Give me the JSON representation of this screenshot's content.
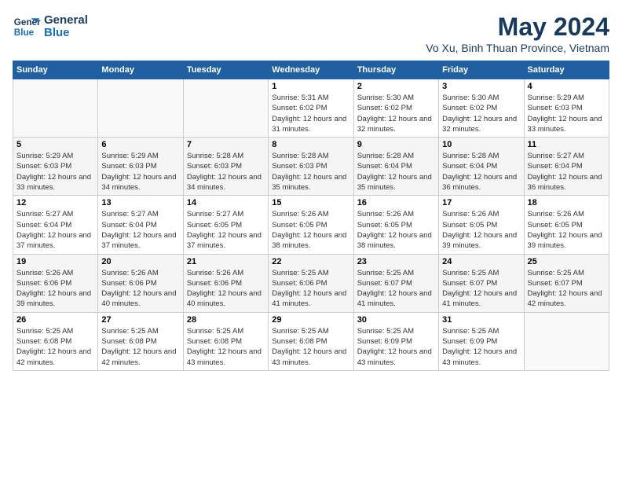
{
  "header": {
    "logo_line1": "General",
    "logo_line2": "Blue",
    "month": "May 2024",
    "location": "Vo Xu, Binh Thuan Province, Vietnam"
  },
  "days_of_week": [
    "Sunday",
    "Monday",
    "Tuesday",
    "Wednesday",
    "Thursday",
    "Friday",
    "Saturday"
  ],
  "weeks": [
    [
      {
        "day": "",
        "sunrise": "",
        "sunset": "",
        "daylight": ""
      },
      {
        "day": "",
        "sunrise": "",
        "sunset": "",
        "daylight": ""
      },
      {
        "day": "",
        "sunrise": "",
        "sunset": "",
        "daylight": ""
      },
      {
        "day": "1",
        "sunrise": "Sunrise: 5:31 AM",
        "sunset": "Sunset: 6:02 PM",
        "daylight": "Daylight: 12 hours and 31 minutes."
      },
      {
        "day": "2",
        "sunrise": "Sunrise: 5:30 AM",
        "sunset": "Sunset: 6:02 PM",
        "daylight": "Daylight: 12 hours and 32 minutes."
      },
      {
        "day": "3",
        "sunrise": "Sunrise: 5:30 AM",
        "sunset": "Sunset: 6:02 PM",
        "daylight": "Daylight: 12 hours and 32 minutes."
      },
      {
        "day": "4",
        "sunrise": "Sunrise: 5:29 AM",
        "sunset": "Sunset: 6:03 PM",
        "daylight": "Daylight: 12 hours and 33 minutes."
      }
    ],
    [
      {
        "day": "5",
        "sunrise": "Sunrise: 5:29 AM",
        "sunset": "Sunset: 6:03 PM",
        "daylight": "Daylight: 12 hours and 33 minutes."
      },
      {
        "day": "6",
        "sunrise": "Sunrise: 5:29 AM",
        "sunset": "Sunset: 6:03 PM",
        "daylight": "Daylight: 12 hours and 34 minutes."
      },
      {
        "day": "7",
        "sunrise": "Sunrise: 5:28 AM",
        "sunset": "Sunset: 6:03 PM",
        "daylight": "Daylight: 12 hours and 34 minutes."
      },
      {
        "day": "8",
        "sunrise": "Sunrise: 5:28 AM",
        "sunset": "Sunset: 6:03 PM",
        "daylight": "Daylight: 12 hours and 35 minutes."
      },
      {
        "day": "9",
        "sunrise": "Sunrise: 5:28 AM",
        "sunset": "Sunset: 6:04 PM",
        "daylight": "Daylight: 12 hours and 35 minutes."
      },
      {
        "day": "10",
        "sunrise": "Sunrise: 5:28 AM",
        "sunset": "Sunset: 6:04 PM",
        "daylight": "Daylight: 12 hours and 36 minutes."
      },
      {
        "day": "11",
        "sunrise": "Sunrise: 5:27 AM",
        "sunset": "Sunset: 6:04 PM",
        "daylight": "Daylight: 12 hours and 36 minutes."
      }
    ],
    [
      {
        "day": "12",
        "sunrise": "Sunrise: 5:27 AM",
        "sunset": "Sunset: 6:04 PM",
        "daylight": "Daylight: 12 hours and 37 minutes."
      },
      {
        "day": "13",
        "sunrise": "Sunrise: 5:27 AM",
        "sunset": "Sunset: 6:04 PM",
        "daylight": "Daylight: 12 hours and 37 minutes."
      },
      {
        "day": "14",
        "sunrise": "Sunrise: 5:27 AM",
        "sunset": "Sunset: 6:05 PM",
        "daylight": "Daylight: 12 hours and 37 minutes."
      },
      {
        "day": "15",
        "sunrise": "Sunrise: 5:26 AM",
        "sunset": "Sunset: 6:05 PM",
        "daylight": "Daylight: 12 hours and 38 minutes."
      },
      {
        "day": "16",
        "sunrise": "Sunrise: 5:26 AM",
        "sunset": "Sunset: 6:05 PM",
        "daylight": "Daylight: 12 hours and 38 minutes."
      },
      {
        "day": "17",
        "sunrise": "Sunrise: 5:26 AM",
        "sunset": "Sunset: 6:05 PM",
        "daylight": "Daylight: 12 hours and 39 minutes."
      },
      {
        "day": "18",
        "sunrise": "Sunrise: 5:26 AM",
        "sunset": "Sunset: 6:05 PM",
        "daylight": "Daylight: 12 hours and 39 minutes."
      }
    ],
    [
      {
        "day": "19",
        "sunrise": "Sunrise: 5:26 AM",
        "sunset": "Sunset: 6:06 PM",
        "daylight": "Daylight: 12 hours and 39 minutes."
      },
      {
        "day": "20",
        "sunrise": "Sunrise: 5:26 AM",
        "sunset": "Sunset: 6:06 PM",
        "daylight": "Daylight: 12 hours and 40 minutes."
      },
      {
        "day": "21",
        "sunrise": "Sunrise: 5:26 AM",
        "sunset": "Sunset: 6:06 PM",
        "daylight": "Daylight: 12 hours and 40 minutes."
      },
      {
        "day": "22",
        "sunrise": "Sunrise: 5:25 AM",
        "sunset": "Sunset: 6:06 PM",
        "daylight": "Daylight: 12 hours and 41 minutes."
      },
      {
        "day": "23",
        "sunrise": "Sunrise: 5:25 AM",
        "sunset": "Sunset: 6:07 PM",
        "daylight": "Daylight: 12 hours and 41 minutes."
      },
      {
        "day": "24",
        "sunrise": "Sunrise: 5:25 AM",
        "sunset": "Sunset: 6:07 PM",
        "daylight": "Daylight: 12 hours and 41 minutes."
      },
      {
        "day": "25",
        "sunrise": "Sunrise: 5:25 AM",
        "sunset": "Sunset: 6:07 PM",
        "daylight": "Daylight: 12 hours and 42 minutes."
      }
    ],
    [
      {
        "day": "26",
        "sunrise": "Sunrise: 5:25 AM",
        "sunset": "Sunset: 6:08 PM",
        "daylight": "Daylight: 12 hours and 42 minutes."
      },
      {
        "day": "27",
        "sunrise": "Sunrise: 5:25 AM",
        "sunset": "Sunset: 6:08 PM",
        "daylight": "Daylight: 12 hours and 42 minutes."
      },
      {
        "day": "28",
        "sunrise": "Sunrise: 5:25 AM",
        "sunset": "Sunset: 6:08 PM",
        "daylight": "Daylight: 12 hours and 43 minutes."
      },
      {
        "day": "29",
        "sunrise": "Sunrise: 5:25 AM",
        "sunset": "Sunset: 6:08 PM",
        "daylight": "Daylight: 12 hours and 43 minutes."
      },
      {
        "day": "30",
        "sunrise": "Sunrise: 5:25 AM",
        "sunset": "Sunset: 6:09 PM",
        "daylight": "Daylight: 12 hours and 43 minutes."
      },
      {
        "day": "31",
        "sunrise": "Sunrise: 5:25 AM",
        "sunset": "Sunset: 6:09 PM",
        "daylight": "Daylight: 12 hours and 43 minutes."
      },
      {
        "day": "",
        "sunrise": "",
        "sunset": "",
        "daylight": ""
      }
    ]
  ]
}
